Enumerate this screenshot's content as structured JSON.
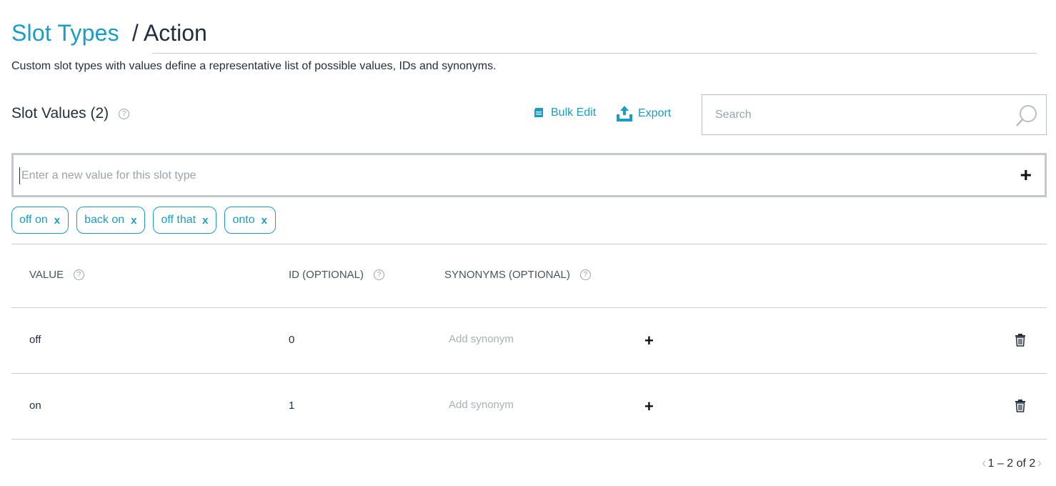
{
  "header": {
    "breadcrumb_link": "Slot Types",
    "breadcrumb_current": "/ Action",
    "subtitle": "Custom slot types with values define a representative list of possible values, IDs and synonyms."
  },
  "section": {
    "title": "Slot Values (2)",
    "help": "?",
    "bulk_edit_label": "Bulk Edit",
    "export_label": "Export"
  },
  "search": {
    "placeholder": "Search"
  },
  "new_value": {
    "placeholder": "Enter a new value for this slot type",
    "add": "+"
  },
  "suggestions": [
    {
      "label": "off on",
      "remove": "x"
    },
    {
      "label": "back on",
      "remove": "x"
    },
    {
      "label": "off that",
      "remove": "x"
    },
    {
      "label": "onto",
      "remove": "x"
    }
  ],
  "table": {
    "headers": {
      "value": "VALUE",
      "id": "ID (OPTIONAL)",
      "synonyms": "SYNONYMS (OPTIONAL)",
      "help": "?"
    },
    "rows": [
      {
        "value": "off",
        "id": "0",
        "synonym_placeholder": "Add synonym",
        "add": "+"
      },
      {
        "value": "on",
        "id": "1",
        "synonym_placeholder": "Add synonym",
        "add": "+"
      }
    ]
  },
  "pagination": {
    "range": "1 – 2 of 2",
    "prev": "‹",
    "next": "›"
  },
  "colors": {
    "accent": "#1a9cc7",
    "text": "#232f3e",
    "muted": "#9aa3ab",
    "border": "#c9ced3"
  }
}
